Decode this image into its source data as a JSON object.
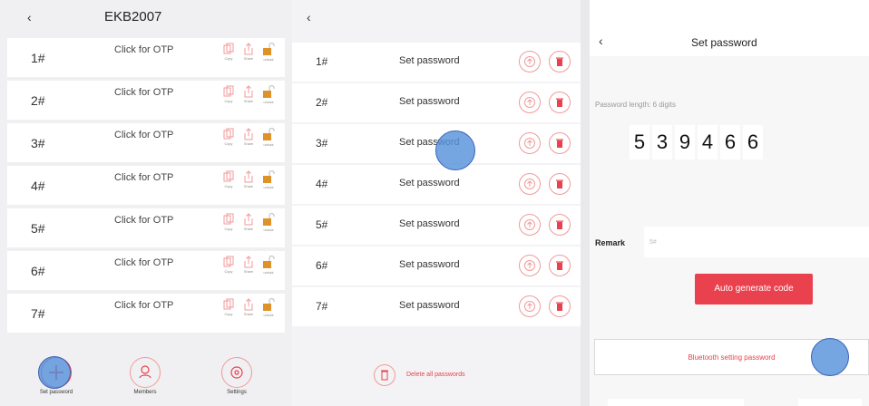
{
  "list_panel": {
    "title": "EKB2007",
    "rows": [
      {
        "num": "1#",
        "otp": "Click for OTP"
      },
      {
        "num": "2#",
        "otp": "Click for OTP"
      },
      {
        "num": "3#",
        "otp": "Click for OTP"
      },
      {
        "num": "4#",
        "otp": "Click for OTP"
      },
      {
        "num": "5#",
        "otp": "Click for OTP"
      },
      {
        "num": "6#",
        "otp": "Click for OTP"
      },
      {
        "num": "7#",
        "otp": "Click for OTP"
      }
    ],
    "actions": {
      "copy": "Copy",
      "share": "Share",
      "unlock": "unlock"
    },
    "bottom": {
      "set_password": "Set password",
      "members": "Members",
      "settings": "Settings"
    }
  },
  "password_panel": {
    "rows": [
      {
        "num": "1#",
        "label": "Set password"
      },
      {
        "num": "2#",
        "label": "Set password"
      },
      {
        "num": "3#",
        "label": "Set password"
      },
      {
        "num": "4#",
        "label": "Set password"
      },
      {
        "num": "5#",
        "label": "Set password"
      },
      {
        "num": "6#",
        "label": "Set password"
      },
      {
        "num": "7#",
        "label": "Set password"
      }
    ],
    "delete_all": "Delete all passwords"
  },
  "set_password_panel": {
    "title": "Set password",
    "length_label": "Password length: 6 digits",
    "digits": [
      "5",
      "3",
      "9",
      "4",
      "6",
      "6"
    ],
    "remark_label": "Remark",
    "remark_value": "5#",
    "auto_generate": "Auto generate code",
    "bluetooth_button": "Bluetooth setting password"
  },
  "colors": {
    "accent_red": "#e9414e",
    "icon_pink": "#f09a9a",
    "touch_blue": "#5892dc"
  }
}
